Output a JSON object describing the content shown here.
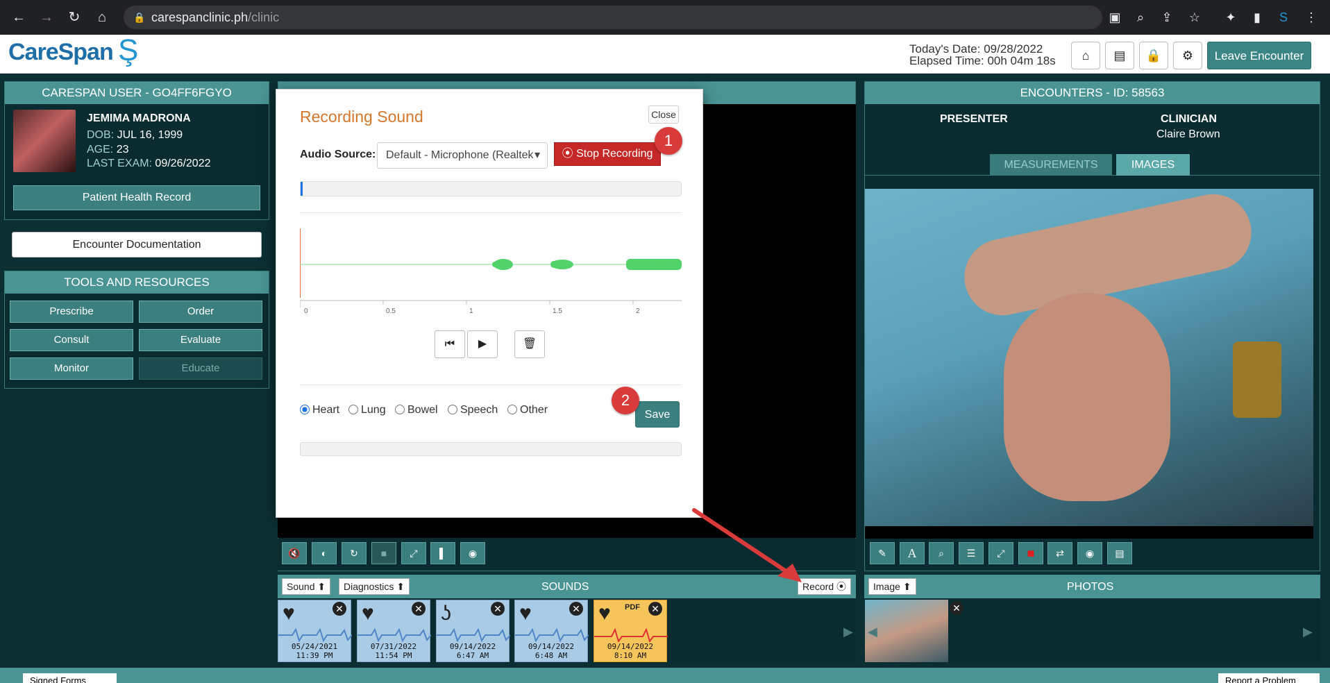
{
  "browser": {
    "url_host": "carespanclinic.ph",
    "url_path": "/clinic"
  },
  "header": {
    "logo": "CareSpan",
    "today_date": "Today's Date: 09/28/2022",
    "elapsed": "Elapsed Time: 00h 04m 18s",
    "leave": "Leave Encounter"
  },
  "user_panel": {
    "title": "CARESPAN USER - GO4FF6FGYO",
    "patient_name": "JEMIMA MADRONA",
    "dob_label": "DOB:",
    "dob": "JUL 16, 1999",
    "age_label": "AGE:",
    "age": "23",
    "last_exam_label": "LAST EXAM:",
    "last_exam": "09/26/2022",
    "phr_button": "Patient Health Record"
  },
  "encounter_doc_button": "Encounter Documentation",
  "tools": {
    "title": "TOOLS AND RESOURCES",
    "buttons": [
      "Prescribe",
      "Order",
      "Consult",
      "Evaluate",
      "Monitor",
      "Educate"
    ]
  },
  "modal": {
    "title": "Recording Sound",
    "close": "Close",
    "audio_source_label": "Audio Source:",
    "audio_source_value": "Default - Microphone (Realtek",
    "stop_recording": "Stop Recording",
    "axis_ticks": [
      "0",
      "0.5",
      "1",
      "1.5",
      "2"
    ],
    "radio_options": [
      "Heart",
      "Lung",
      "Bowel",
      "Speech",
      "Other"
    ],
    "selected_radio": "Heart",
    "save": "Save"
  },
  "annotations": {
    "badge1": "1",
    "badge2": "2"
  },
  "encounters_panel": {
    "title": "ENCOUNTERS - ID: 58563",
    "presenter_label": "PRESENTER",
    "clinician_label": "CLINICIAN",
    "clinician_name": "Claire Brown",
    "tabs": [
      "MEASUREMENTS",
      "IMAGES"
    ],
    "active_tab": "IMAGES"
  },
  "sounds_bar": {
    "sound_btn": "Sound",
    "diagnostics_btn": "Diagnostics",
    "title": "SOUNDS",
    "record_btn": "Record"
  },
  "sound_thumbs": [
    {
      "type": "heart",
      "date": "05/24/2021",
      "time": "11:39 PM"
    },
    {
      "type": "heart",
      "date": "07/31/2022",
      "time": "11:54 PM"
    },
    {
      "type": "ear",
      "date": "09/14/2022",
      "time": "6:47 AM"
    },
    {
      "type": "heart",
      "date": "09/14/2022",
      "time": "6:48 AM"
    },
    {
      "type": "pdf",
      "label": "PDF",
      "date": "09/14/2022",
      "time": "8:10 AM"
    }
  ],
  "photos_bar": {
    "image_btn": "Image",
    "title": "PHOTOS"
  },
  "footer": {
    "signed_forms": "Signed Forms",
    "report_problem": "Report a Problem"
  },
  "colors": {
    "teal": "#4a9494",
    "dark": "#0a2c30",
    "accent_orange": "#d4772b",
    "record_red": "#c62828"
  }
}
